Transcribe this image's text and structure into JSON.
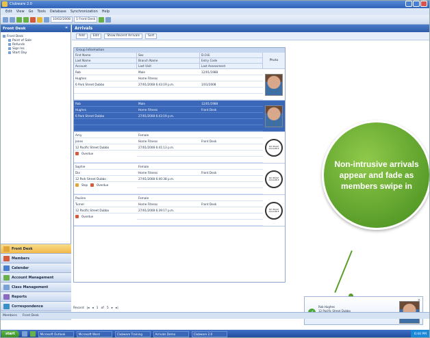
{
  "window": {
    "title": "Clubware 2.0"
  },
  "menu": [
    "Edit",
    "View",
    "Go",
    "Tools",
    "Database",
    "Synchronization",
    "Help"
  ],
  "toolbar": {
    "field1": "10/02/2008",
    "field2": "1 Front Desk"
  },
  "left_pane": {
    "title": "Front Desk",
    "tree": [
      {
        "label": "Front Desk",
        "level": 1
      },
      {
        "label": "Point of Sale",
        "level": 2
      },
      {
        "label": "Refunds",
        "level": 2
      },
      {
        "label": "Sign Ins",
        "level": 2
      },
      {
        "label": "Start Day",
        "level": 2
      }
    ],
    "nav": [
      {
        "label": "Front Desk",
        "active": true,
        "color": "#e2a53b"
      },
      {
        "label": "Members",
        "active": false,
        "color": "#d35a3a"
      },
      {
        "label": "Calendar",
        "active": false,
        "color": "#4a7cc9"
      },
      {
        "label": "Account Management",
        "active": false,
        "color": "#69b04a"
      },
      {
        "label": "Class Management",
        "active": false,
        "color": "#7aa0d4"
      },
      {
        "label": "Reports",
        "active": false,
        "color": "#8a6bbf"
      },
      {
        "label": "Correspondence",
        "active": false,
        "color": "#3a8fc9"
      },
      {
        "label": "Administration",
        "active": false,
        "color": "#d35a3a"
      }
    ]
  },
  "main": {
    "title": "Arrivals",
    "toolbar": [
      "Add",
      "Edit",
      "Show Recent Arrivals",
      "Sort"
    ],
    "group_title": "Group Information",
    "headers": [
      [
        "First Name",
        "Sex",
        "D.O.B."
      ],
      [
        "Last Name",
        "Branch Name",
        "Entry Code"
      ],
      [
        "Account",
        "Last Visit",
        "Last Assessment"
      ]
    ],
    "photo_label": "Photo",
    "records": [
      {
        "rows": [
          [
            "Rob",
            "Male",
            "12/01/1988"
          ],
          [
            "Hughes",
            "Home Fitness",
            ""
          ],
          [
            "6 Park Street Dubbo",
            "27/01/2008 6:43:19 p.m.",
            "1/01/2008"
          ]
        ],
        "photo": "face",
        "selected": false,
        "actions": []
      },
      {
        "rows": [
          [
            "Rob",
            "Male",
            "12/01/1988"
          ],
          [
            "Hughes",
            "Home Fitness",
            "Front Desk"
          ],
          [
            "6 Park Street Dubbo",
            "27/01/2008 6:43:19 p.m.",
            ""
          ]
        ],
        "photo": "face",
        "selected": true,
        "actions": []
      },
      {
        "rows": [
          [
            "Amy",
            "Female",
            ""
          ],
          [
            "Jones",
            "Home Fitness",
            "Front Desk"
          ],
          [
            "12 Pacific Street Dubbo",
            "27/01/2008 6:41:13 p.m.",
            ""
          ]
        ],
        "photo": "none",
        "selected": false,
        "actions": [
          "Overdue"
        ]
      },
      {
        "rows": [
          [
            "Sophie",
            "Female",
            ""
          ],
          [
            "Dix",
            "Home Fitness",
            "Front Desk"
          ],
          [
            "12 Park Street Dubbo",
            "27/01/2008 6:40:38 p.m.",
            ""
          ]
        ],
        "photo": "none",
        "selected": false,
        "actions": [
          "Stop",
          "Overdue"
        ]
      },
      {
        "rows": [
          [
            "Pauline",
            "Female",
            ""
          ],
          [
            "Turner",
            "Home Fitness",
            "Front Desk"
          ],
          [
            "12 Pacific Street Dubbo",
            "27/01/2008 6:39:17 p.m.",
            ""
          ]
        ],
        "photo": "none",
        "selected": false,
        "actions": [
          "Overdue"
        ]
      }
    ],
    "no_image_text": "NO IMAGE AVAILABLE",
    "pager": [
      "Record",
      "1",
      "of",
      "5"
    ]
  },
  "callout": {
    "text": "Non-intrusive arrivals appear and fade as members swipe in"
  },
  "toast": {
    "line1": "Rob Hughes",
    "line2": "12 Pacific Street Dubbo",
    "line3": "Signed in"
  },
  "status": [
    "Members",
    "Front Desk"
  ],
  "taskbar": {
    "start": "start",
    "tasks": [
      "Microsoft Outlook",
      "Microsoft Word",
      "Clubware Training",
      "Arrivals Demo",
      "Clubware 2.0"
    ],
    "clock": "6:44 PM"
  }
}
